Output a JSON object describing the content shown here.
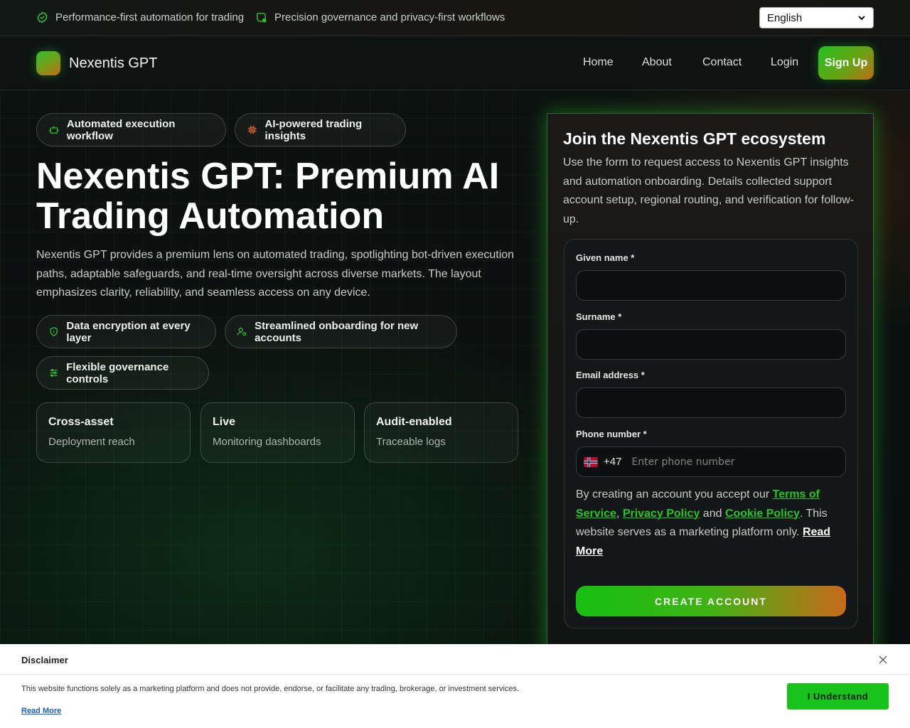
{
  "topbar": {
    "item1": "Performance-first automation for trading",
    "item2": "Precision governance and privacy-first workflows",
    "language": "English"
  },
  "nav": {
    "brand": "Nexentis GPT",
    "links": [
      "Home",
      "About",
      "Contact",
      "Login"
    ],
    "signup": "Sign Up"
  },
  "hero": {
    "chips_top": [
      "Automated execution workflow",
      "AI-powered trading insights"
    ],
    "title": "Nexentis GPT: Premium AI Trading Automation",
    "description": "Nexentis GPT provides a premium lens on automated trading, spotlighting bot-driven execution paths, adaptable safeguards, and real-time oversight across diverse markets. The layout emphasizes clarity, reliability, and seamless access on any device.",
    "chips_features": [
      "Data encryption at every layer",
      "Streamlined onboarding for new accounts",
      "Flexible governance controls"
    ],
    "stats": [
      {
        "title": "Cross-asset",
        "sub": "Deployment reach"
      },
      {
        "title": "Live",
        "sub": "Monitoring dashboards"
      },
      {
        "title": "Audit-enabled",
        "sub": "Traceable logs"
      }
    ]
  },
  "form": {
    "title": "Join the Nexentis GPT ecosystem",
    "description": "Use the form to request access to Nexentis GPT insights and automation onboarding. Details collected support account setup, regional routing, and verification for follow-up.",
    "given_name_label": "Given name *",
    "surname_label": "Surname *",
    "email_label": "Email address *",
    "phone_label": "Phone number *",
    "dial_code": "+47",
    "phone_placeholder": "Enter phone number",
    "terms_prefix": "By creating an account you accept our ",
    "terms_link": "Terms of Service",
    "privacy_link": "Privacy Policy",
    "and": " and ",
    "cookie_link": "Cookie Policy",
    "terms_suffix": ". This website serves as a marketing platform only. ",
    "read_more": "Read More",
    "submit": "CREATE ACCOUNT"
  },
  "disclaimer": {
    "title": "Disclaimer",
    "text": "This website functions solely as a marketing platform and does not provide, endorse, or facilitate any trading, brokerage, or investment services.",
    "read_more": "Read More",
    "button": "I Understand"
  },
  "colors": {
    "accent_green": "#21c21e",
    "accent_orange": "#c36a18",
    "background": "#0b0f0e"
  }
}
